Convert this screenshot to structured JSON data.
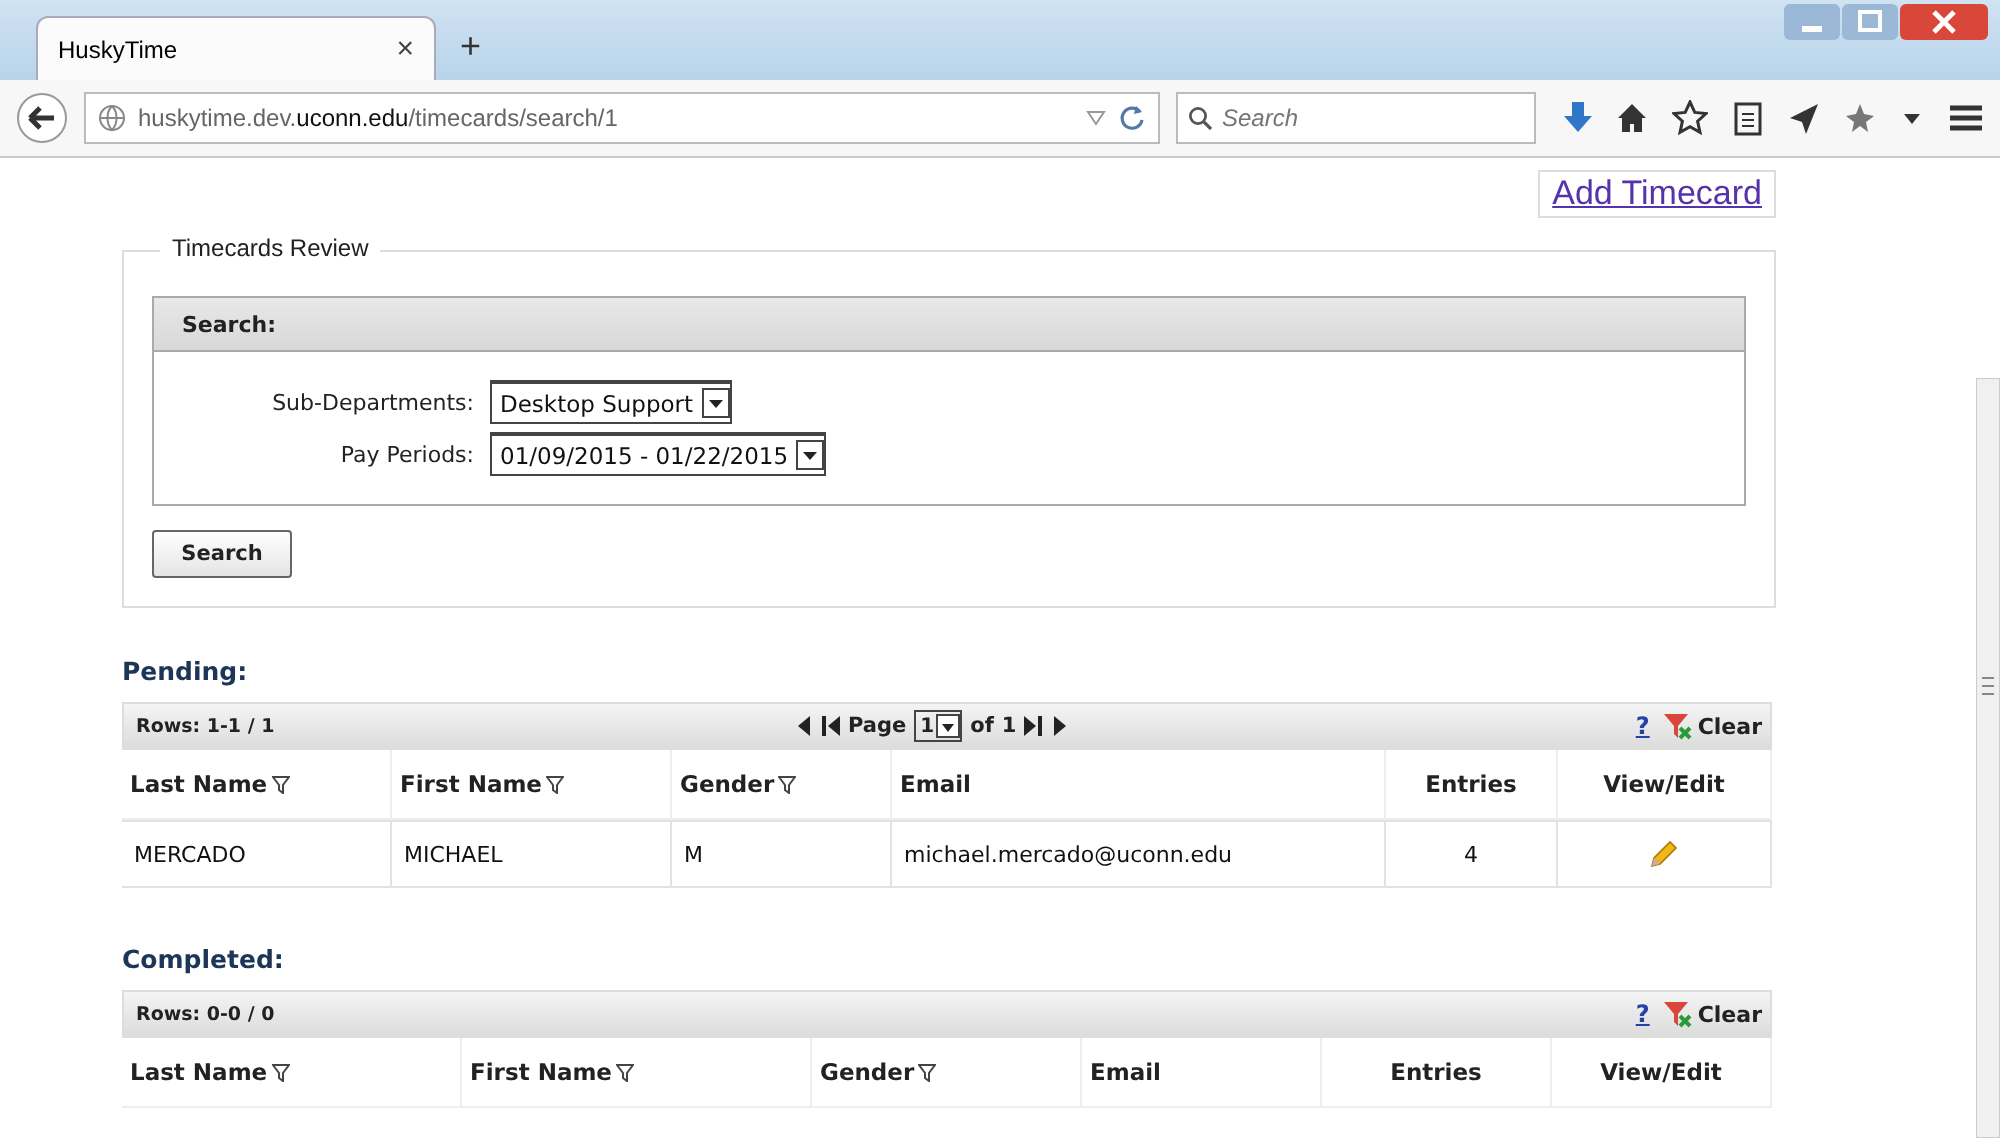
{
  "browser": {
    "tab_title": "HuskyTime",
    "tab_close": "×",
    "new_tab": "+",
    "url": "huskytime.dev.**uconn.edu**/timecards/search/1",
    "search_placeholder": "Search"
  },
  "add_link": "Add Timecard",
  "review": {
    "title": "Timecards Review",
    "search_header": "Search:",
    "fields": [
      {
        "label": "Sub-Departments:",
        "value": "Desktop Support"
      },
      {
        "label": "Pay Periods:",
        "value": "01/09/2015 - 01/22/2015"
      }
    ],
    "button": "Search"
  },
  "grids": [
    {
      "title": "Pending:",
      "rows_info": "Rows: 1-1 / 1",
      "pager": {
        "page_label": "Page",
        "page": "1",
        "of_label": "of",
        "total": "1"
      },
      "help": "?",
      "clear": "Clear",
      "columns": [
        {
          "label": "Last Name",
          "filter": true
        },
        {
          "label": "First Name",
          "filter": true
        },
        {
          "label": "Gender",
          "filter": true
        },
        {
          "label": "Email",
          "filter": false
        },
        {
          "label": "Entries",
          "filter": false
        },
        {
          "label": "View/Edit",
          "filter": false
        }
      ],
      "rows": [
        {
          "cells": [
            "MERCADO",
            "MICHAEL",
            "M",
            "michael.mercado@uconn.edu",
            "4"
          ],
          "editable": true
        }
      ]
    },
    {
      "title": "Completed:",
      "rows_info": "Rows: 0-0 / 0",
      "help": "?",
      "clear": "Clear",
      "columns": [
        {
          "label": "Last Name",
          "filter": true
        },
        {
          "label": "First Name",
          "filter": true
        },
        {
          "label": "Gender",
          "filter": true
        },
        {
          "label": "Email",
          "filter": false
        },
        {
          "label": "Entries",
          "filter": false
        },
        {
          "label": "View/Edit",
          "filter": false
        }
      ]
    }
  ]
}
